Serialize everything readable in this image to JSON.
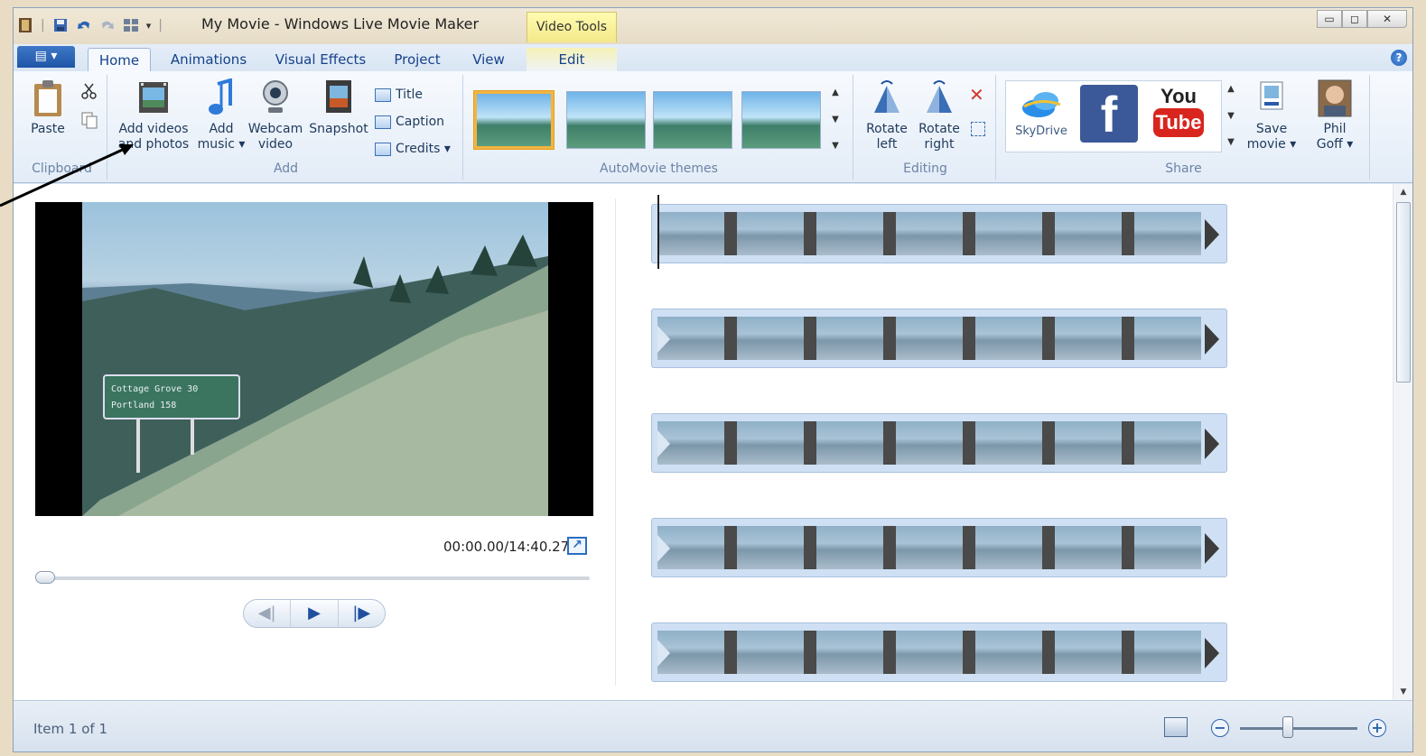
{
  "titlebar": {
    "title": "My Movie - Windows Live Movie Maker",
    "contextual_tab": "Video Tools",
    "window_buttons": [
      "▭",
      "◻",
      "✕"
    ]
  },
  "tabs": {
    "file_menu_label": "▤ ▾",
    "items": [
      {
        "label": "Home"
      },
      {
        "label": "Animations"
      },
      {
        "label": "Visual Effects"
      },
      {
        "label": "Project"
      },
      {
        "label": "View"
      },
      {
        "label": "Edit"
      }
    ],
    "help": "?"
  },
  "ribbon": {
    "clipboard": {
      "label": "Clipboard",
      "paste": "Paste"
    },
    "add": {
      "label": "Add",
      "add_videos_1": "Add videos",
      "add_videos_2": "and photos",
      "add_music_1": "Add",
      "add_music_2": "music ▾",
      "webcam_1": "Webcam",
      "webcam_2": "video",
      "snapshot": "Snapshot",
      "title": "Title",
      "caption": "Caption",
      "credits": "Credits ▾"
    },
    "themes": {
      "label": "AutoMovie themes"
    },
    "editing": {
      "label": "Editing",
      "rotate_left_1": "Rotate",
      "rotate_left_2": "left",
      "rotate_right_1": "Rotate",
      "rotate_right_2": "right"
    },
    "share": {
      "label": "Share",
      "skydrive": "SkyDrive",
      "youtube_1": "You",
      "youtube_2": "Tube",
      "save_movie_1": "Save",
      "save_movie_2": "movie ▾",
      "user_1": "Phil",
      "user_2": "Goff ▾"
    }
  },
  "preview": {
    "timecode": "00:00.00/14:40.27",
    "sign_line1": "Cottage Grove  30",
    "sign_line2": "Portland      158"
  },
  "statusbar": {
    "text": "Item 1 of 1"
  },
  "colors": {
    "accent": "#1f55a6",
    "ribbon_bg": "#e3ecf7",
    "contextual_tab": "#fffbb0",
    "theme_selected": "#f2b443"
  }
}
